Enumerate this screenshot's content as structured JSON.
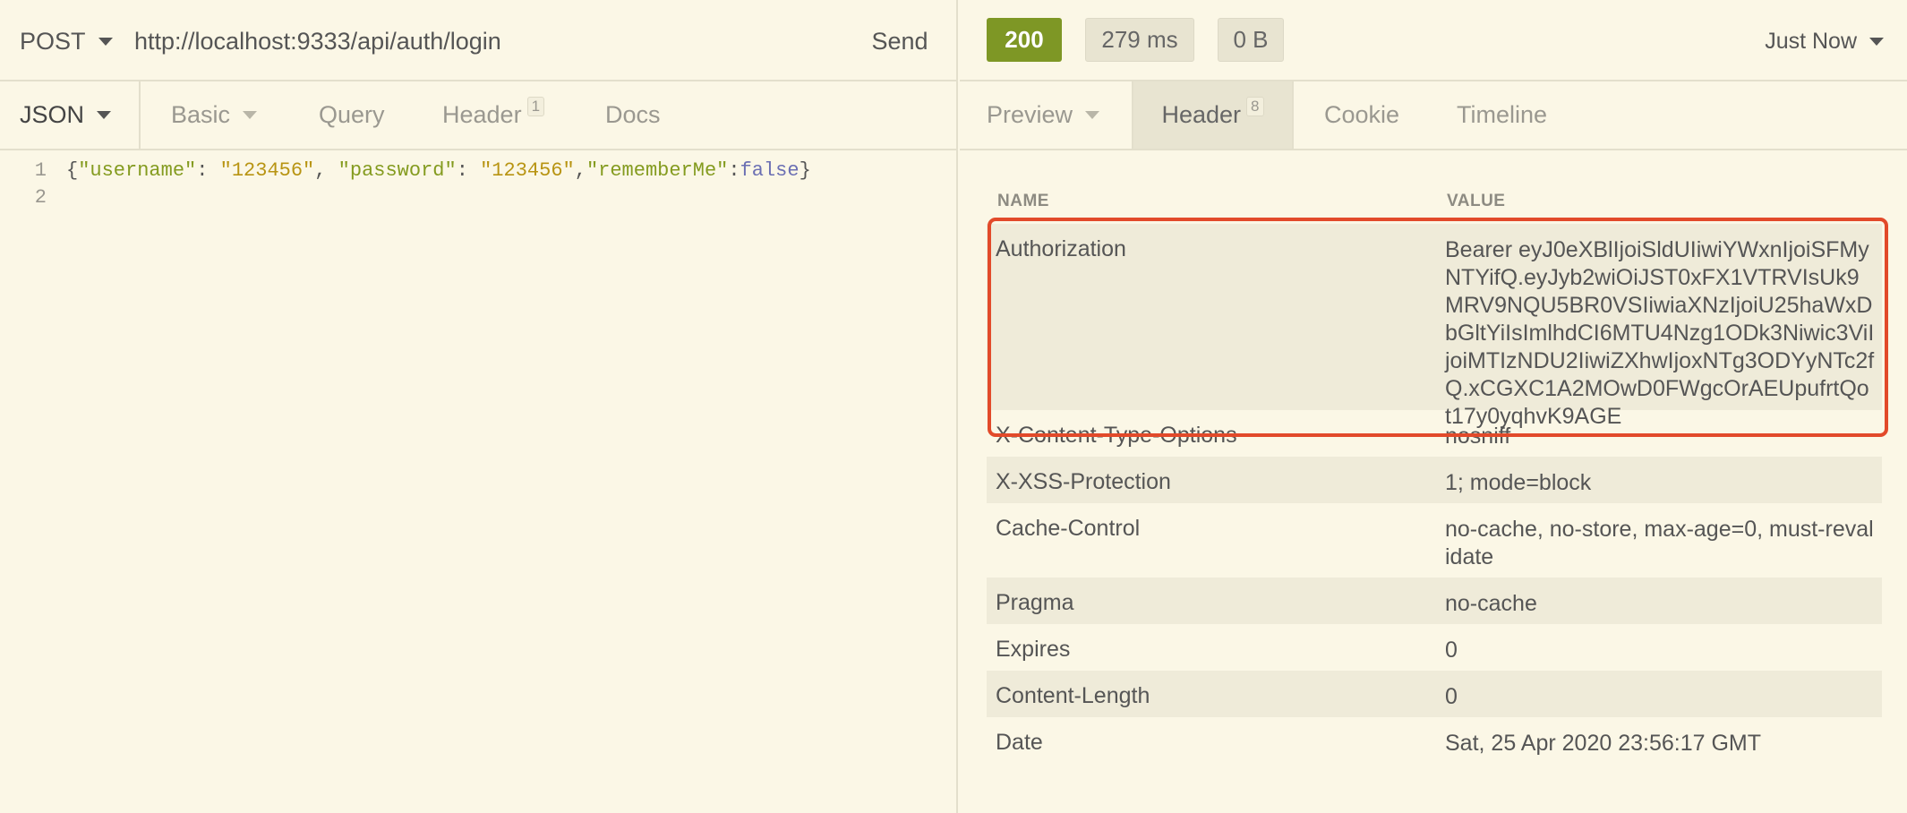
{
  "request": {
    "method": "POST",
    "url": "http://localhost:9333/api/auth/login",
    "send_label": "Send",
    "body_type": "JSON",
    "tabs": [
      {
        "label": "Basic"
      },
      {
        "label": "Query"
      },
      {
        "label": "Header",
        "badge": "1"
      },
      {
        "label": "Docs"
      }
    ],
    "body_lines": [
      {
        "num": "1"
      },
      {
        "num": "2"
      }
    ],
    "body_tokens": {
      "open": "{",
      "k1": "\"username\"",
      "c1": ": ",
      "v1": "\"123456\"",
      "sep1": ", ",
      "k2": "\"password\"",
      "c2": ": ",
      "v2": "\"123456\"",
      "sep2": ",",
      "k3": "\"rememberMe\"",
      "c3": ":",
      "v3": "false",
      "close": "}"
    }
  },
  "response": {
    "status_code": "200",
    "time": "279 ms",
    "size": "0 B",
    "history_label": "Just Now",
    "tabs": [
      {
        "label": "Preview"
      },
      {
        "label": "Header",
        "badge": "8"
      },
      {
        "label": "Cookie"
      },
      {
        "label": "Timeline"
      }
    ],
    "headers_table": {
      "name_col": "NAME",
      "value_col": "VALUE",
      "rows": [
        {
          "name": "Authorization",
          "value": "Bearer eyJ0eXBlIjoiSldUIiwiYWxnIjoiSFMyNTYifQ.eyJyb2wiOiJST0xFX1VTRVIsUk9MRV9NQU5BR0VSIiwiaXNzIjoiU25haWxDbGltYiIsImlhdCI6MTU4Nzg1ODk3Niwic3ViIjoiMTIzNDU2IiwiZXhwIjoxNTg3ODYyNTc2fQ.xCGXC1A2MOwD0FWgcOrAEUpufrtQot17y0yqhvK9AGE"
        },
        {
          "name": "X-Content-Type-Options",
          "value": "nosniff"
        },
        {
          "name": "X-XSS-Protection",
          "value": "1; mode=block"
        },
        {
          "name": "Cache-Control",
          "value": "no-cache, no-store, max-age=0, must-revalidate"
        },
        {
          "name": "Pragma",
          "value": "no-cache"
        },
        {
          "name": "Expires",
          "value": "0"
        },
        {
          "name": "Content-Length",
          "value": "0"
        },
        {
          "name": "Date",
          "value": "Sat, 25 Apr 2020 23:56:17 GMT"
        }
      ]
    }
  },
  "colors": {
    "background": "#fbf7e6",
    "status_ok": "#7e9725",
    "highlight": "#e24a2a"
  }
}
